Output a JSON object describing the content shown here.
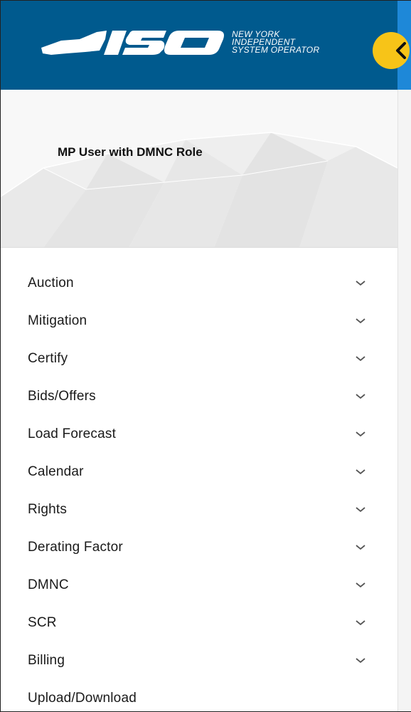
{
  "header": {
    "logo_letters": "ISO",
    "logo_text": [
      "NEW YORK",
      "INDEPENDENT",
      "SYSTEM OPERATOR"
    ],
    "brand_color": "#005a8e",
    "collapse_button_color": "#f7c418"
  },
  "profile": {
    "user_name": "MP User with DMNC Role"
  },
  "menu": {
    "items": [
      {
        "label": "Auction",
        "icon": "chevron-down-icon"
      },
      {
        "label": "Mitigation",
        "icon": "chevron-down-icon"
      },
      {
        "label": "Certify",
        "icon": "chevron-down-icon"
      },
      {
        "label": "Bids/Offers",
        "icon": "chevron-down-icon"
      },
      {
        "label": "Load Forecast",
        "icon": "chevron-down-icon"
      },
      {
        "label": "Calendar",
        "icon": "chevron-down-icon"
      },
      {
        "label": "Rights",
        "icon": "chevron-down-icon"
      },
      {
        "label": "Derating Factor",
        "icon": "chevron-down-icon"
      },
      {
        "label": "DMNC",
        "icon": "chevron-down-icon"
      },
      {
        "label": "SCR",
        "icon": "chevron-down-icon"
      },
      {
        "label": "Billing",
        "icon": "chevron-down-icon"
      },
      {
        "label": "Upload/Download"
      }
    ]
  }
}
